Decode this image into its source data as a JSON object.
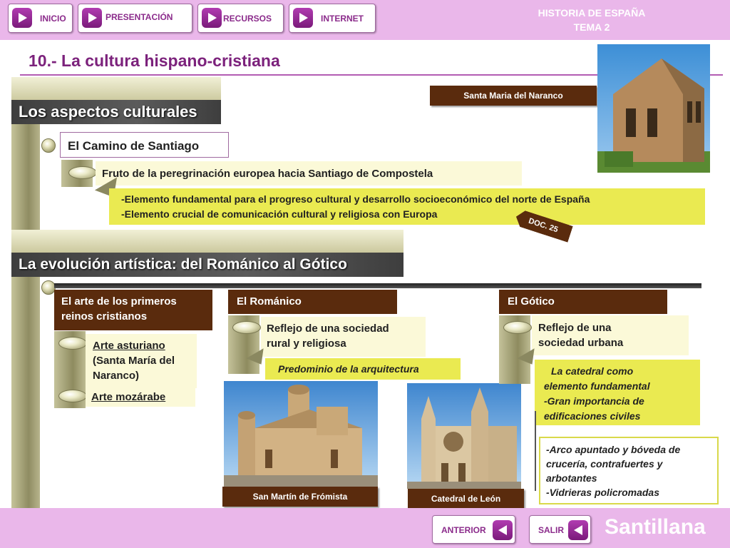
{
  "nav": {
    "items": [
      {
        "label": "INICIO"
      },
      {
        "label": "PRESENTACIÓN"
      },
      {
        "label": "RECURSOS"
      },
      {
        "label": "INTERNET"
      }
    ],
    "header_line1": "HISTORIA DE ESPAÑA",
    "header_line2": "TEMA 2"
  },
  "page": {
    "title": "10.- La cultura hispano-cristiana"
  },
  "section1": {
    "heading": "Los aspectos culturales",
    "item_label": "El Camino de Santiago",
    "sub_label": "Fruto de la peregrinación europea hacia Santiago de Compostela",
    "detail_line1": "-Elemento fundamental para el progreso cultural y desarrollo socioeconómico del norte de España",
    "detail_line2": "-Elemento crucial de comunicación cultural y religiosa con Europa",
    "doc_badge": "DOC. 25",
    "photo_caption": "Santa Maria del Naranco"
  },
  "section2": {
    "heading": "La evolución artística: del Románico al Gótico",
    "col1": {
      "title_line1": "El arte de los primeros",
      "title_line2": "reinos cristianos",
      "link1_line1": "Arte asturiano",
      "link1_line2": "(Santa María del",
      "link1_line3": "Naranco)",
      "link2": "Arte mozárabe"
    },
    "col2": {
      "title": "El Románico",
      "sub_line1": "Reflejo de una sociedad",
      "sub_line2": "rural y religiosa",
      "detail": "Predominio de la arquitectura",
      "photo_caption": "San Martín de Frómista"
    },
    "col3": {
      "title": "El Gótico",
      "sub_line1": "Reflejo de una",
      "sub_line2": "sociedad urbana",
      "detail_line1": "La catedral como",
      "detail_line2": "elemento fundamental",
      "detail_line3": "-Gran importancia de",
      "detail_line4": "edificaciones civiles",
      "note_line1": "-Arco apuntado y bóveda de",
      "note_line2": "crucería, contrafuertes y",
      "note_line3": "arbotantes",
      "note_line4": "-Vidrieras policromadas",
      "photo_caption": "Catedral de León"
    }
  },
  "footer": {
    "prev_label": "ANTERIOR",
    "exit_label": "SALIR",
    "brand": "Santillana"
  },
  "colors": {
    "bar": "#eab7ea",
    "accent": "#7c227c",
    "brown": "#5a2b0d",
    "yellow": "#eaea51"
  },
  "icons": {
    "nav": "play-right-icon",
    "footer": "play-left-icon"
  }
}
